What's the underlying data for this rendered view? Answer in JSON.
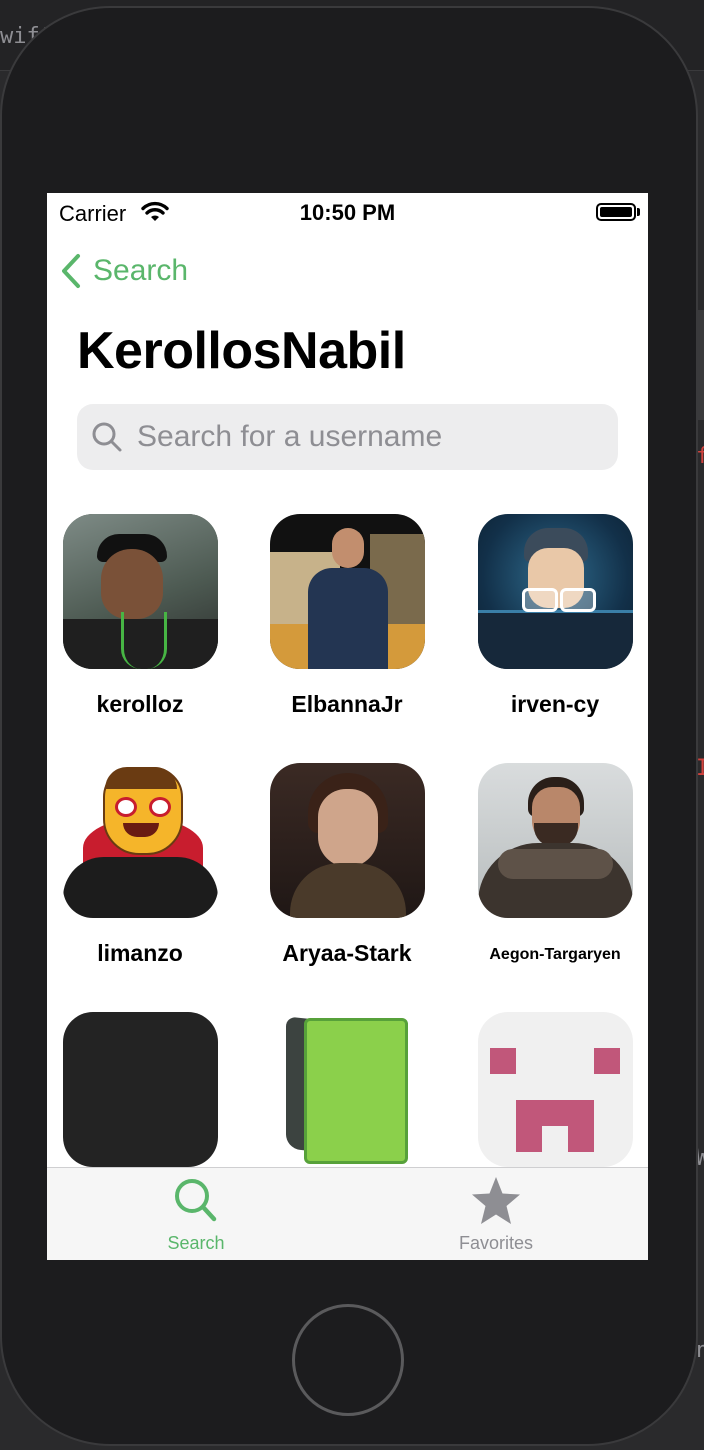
{
  "background": {
    "editor_fragment": "wift",
    "marks": [
      "f",
      "I",
      "W",
      "n"
    ]
  },
  "status_bar": {
    "carrier": "Carrier",
    "time": "10:50 PM"
  },
  "nav": {
    "back_label": "Search",
    "title": "KerollosNabil"
  },
  "search": {
    "placeholder": "Search for a username",
    "value": ""
  },
  "followers": [
    {
      "username": "kerolloz",
      "avatar": "photo of man with lanyard"
    },
    {
      "username": "ElbannaJr",
      "avatar": "photo of man at night"
    },
    {
      "username": "irven-cy",
      "avatar": "cartoon man with glasses"
    },
    {
      "username": "limanzo",
      "avatar": "vampire emoji"
    },
    {
      "username": "Aryaa-Stark",
      "avatar": "portrait of girl"
    },
    {
      "username": "Aegon-Targaryen",
      "avatar": "man in fur coat"
    },
    {
      "username": "",
      "avatar": "dark placeholder"
    },
    {
      "username": "",
      "avatar": "green book"
    },
    {
      "username": "",
      "avatar": "pink identicon"
    }
  ],
  "tab_bar": {
    "tabs": [
      {
        "label": "Search",
        "icon": "magnifier-icon",
        "active": true
      },
      {
        "label": "Favorites",
        "icon": "star-icon",
        "active": false
      }
    ]
  },
  "colors": {
    "accent": "#5ab66b",
    "inactive_tab": "#8e8e93",
    "search_field_bg": "#ededee"
  }
}
